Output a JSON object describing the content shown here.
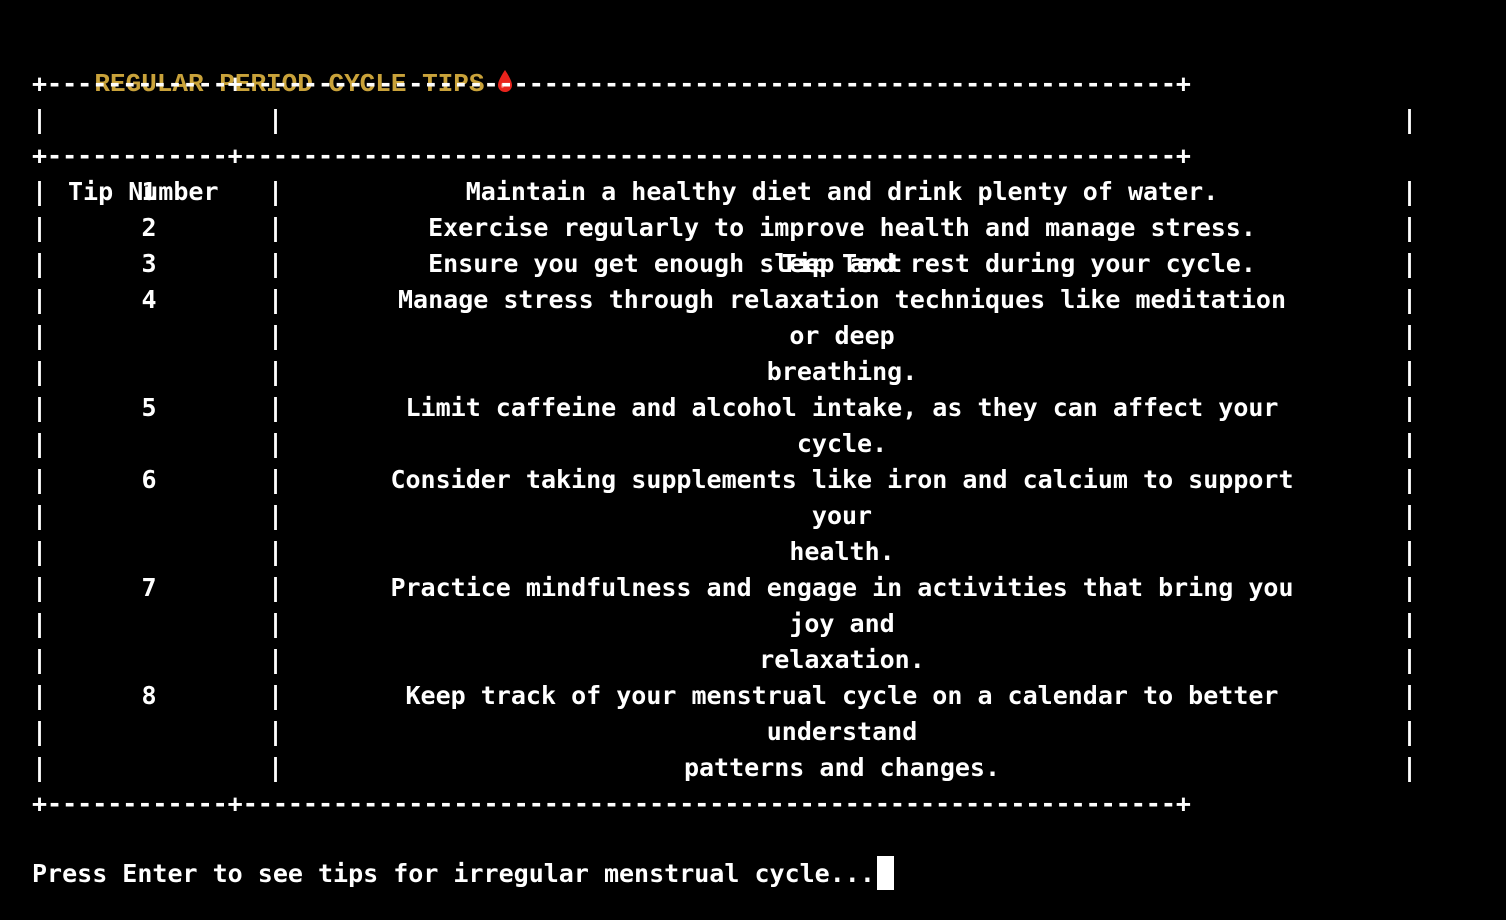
{
  "terminal": {
    "title": "REGULAR PERIOD CYCLE TIPS",
    "title_icon": "blood-drop-icon",
    "title_color": "#c9a23a",
    "icon_color": "#e8231c",
    "border_line": "+------------+--------------------------------------------------------------+",
    "table": {
      "headers": {
        "number": "Tip Number",
        "text": "Tip Text"
      },
      "rows": [
        {
          "number": "1",
          "lines": [
            "Maintain a healthy diet and drink plenty of water."
          ]
        },
        {
          "number": "2",
          "lines": [
            "Exercise regularly to improve health and manage stress."
          ]
        },
        {
          "number": "3",
          "lines": [
            "Ensure you get enough sleep and rest during your cycle."
          ]
        },
        {
          "number": "4",
          "lines": [
            "Manage stress through relaxation techniques like meditation",
            "or deep",
            "breathing."
          ]
        },
        {
          "number": "5",
          "lines": [
            "Limit caffeine and alcohol intake, as they can affect your",
            "cycle."
          ]
        },
        {
          "number": "6",
          "lines": [
            "Consider taking supplements like iron and calcium to support",
            "your",
            "health."
          ]
        },
        {
          "number": "7",
          "lines": [
            "Practice mindfulness and engage in activities that bring you",
            "joy and",
            "relaxation."
          ]
        },
        {
          "number": "8",
          "lines": [
            "Keep track of your menstrual cycle on a calendar to better",
            "understand",
            "patterns and changes."
          ]
        }
      ]
    },
    "prompt": "Press Enter to see tips for irregular menstrual cycle..."
  }
}
